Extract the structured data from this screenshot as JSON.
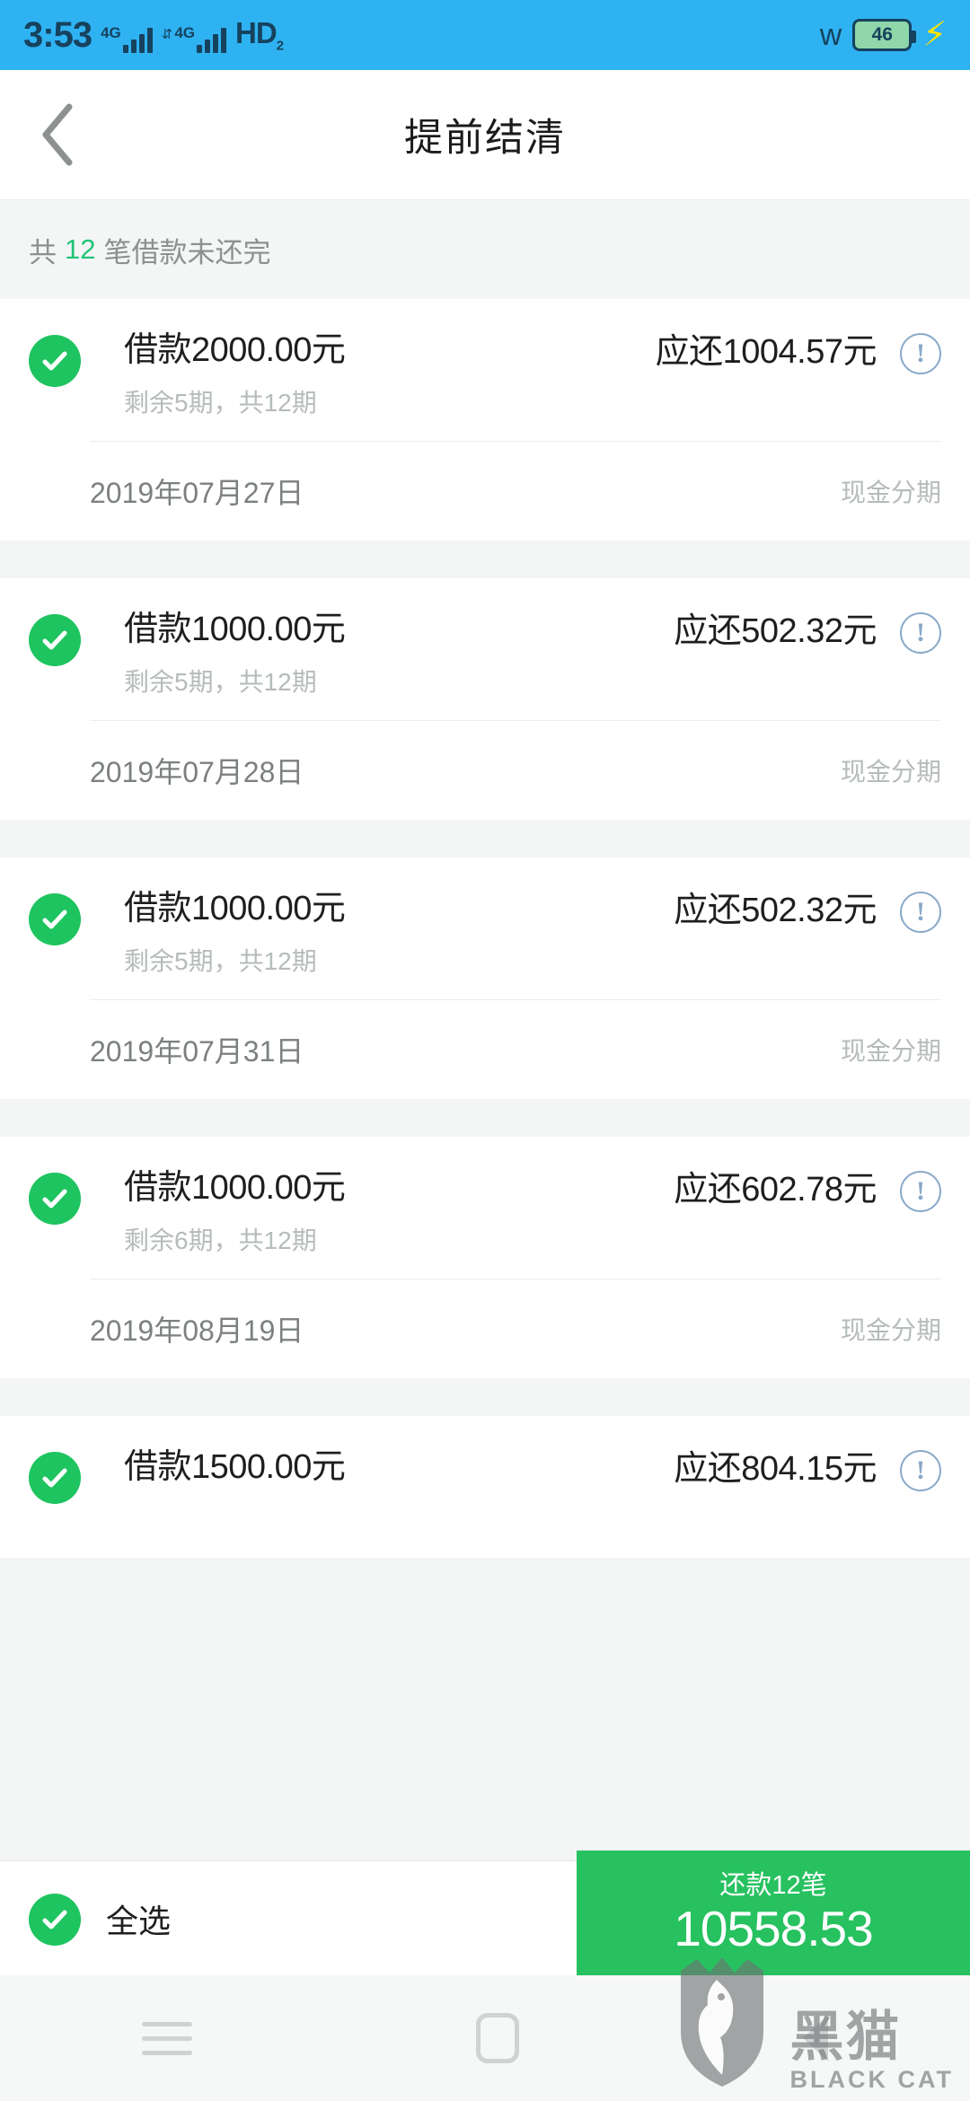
{
  "statusbar": {
    "time": "3:53",
    "network_1": "4G",
    "network_2": "4G",
    "volte": "HD",
    "volte_sub": "2",
    "bluetooth_icon": "bluetooth-icon",
    "battery_level": "46",
    "charging_icon": "lightning-bolt-icon"
  },
  "header": {
    "back_icon": "chevron-left-icon",
    "title": "提前结清"
  },
  "summary": {
    "prefix": "共",
    "count": "12",
    "suffix": "笔借款未还完"
  },
  "loans": [
    {
      "checked": true,
      "principal": "借款2000.00元",
      "terms": "剩余5期，共12期",
      "due": "应还1004.57元",
      "info_icon": "info-exclamation-icon",
      "date": "2019年07月27日",
      "kind": "现金分期"
    },
    {
      "checked": true,
      "principal": "借款1000.00元",
      "terms": "剩余5期，共12期",
      "due": "应还502.32元",
      "info_icon": "info-exclamation-icon",
      "date": "2019年07月28日",
      "kind": "现金分期"
    },
    {
      "checked": true,
      "principal": "借款1000.00元",
      "terms": "剩余5期，共12期",
      "due": "应还502.32元",
      "info_icon": "info-exclamation-icon",
      "date": "2019年07月31日",
      "kind": "现金分期"
    },
    {
      "checked": true,
      "principal": "借款1000.00元",
      "terms": "剩余6期，共12期",
      "due": "应还602.78元",
      "info_icon": "info-exclamation-icon",
      "date": "2019年08月19日",
      "kind": "现金分期"
    },
    {
      "checked": true,
      "principal": "借款1500.00元",
      "terms": "",
      "due": "应还804.15元",
      "info_icon": "info-exclamation-icon",
      "date": "",
      "kind": ""
    }
  ],
  "bottombar": {
    "select_all_label": "全选",
    "select_all_checked": true,
    "pay_count_label": "还款12笔",
    "pay_amount": "10558.53"
  },
  "navbar": {
    "menu_icon": "hamburger-menu-icon",
    "home_icon": "home-square-icon",
    "back_icon": "back-triangle-icon"
  },
  "watermark": {
    "logo_icon": "black-cat-shield-icon",
    "cn": "黑猫",
    "en": "BLACK CAT"
  },
  "colors": {
    "status_bar": "#2fb2f2",
    "accent_green": "#1ec45f",
    "pay_button_green": "#27c160",
    "summary_count_green": "#21c477",
    "info_blue": "#8aa9c9",
    "page_bg": "#f4f5f5"
  }
}
